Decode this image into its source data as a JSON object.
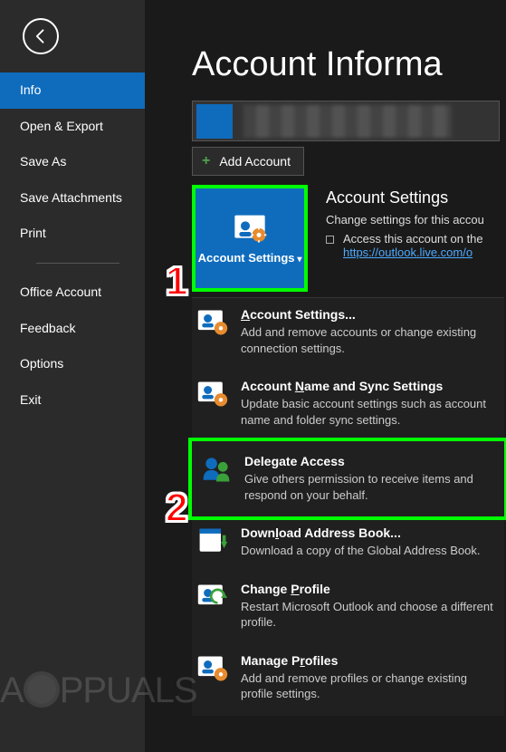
{
  "sidebar": {
    "items": [
      {
        "label": "Info"
      },
      {
        "label": "Open & Export"
      },
      {
        "label": "Save As"
      },
      {
        "label": "Save Attachments"
      },
      {
        "label": "Print"
      },
      {
        "label": "Office Account"
      },
      {
        "label": "Feedback"
      },
      {
        "label": "Options"
      },
      {
        "label": "Exit"
      }
    ],
    "active_index": 0
  },
  "main": {
    "title": "Account Informa",
    "add_account_label": "Add Account",
    "tile": {
      "label": "Account Settings"
    },
    "tile_info": {
      "title": "Account Settings",
      "subtitle": "Change settings for this accou",
      "bullet_text": "Access this account on the",
      "bullet_link": "https://outlook.live.com/o"
    },
    "dropdown": [
      {
        "title_pre": "",
        "title_ul": "A",
        "title_post": "ccount Settings...",
        "desc": "Add and remove accounts or change existing connection settings."
      },
      {
        "title_pre": "Account ",
        "title_ul": "N",
        "title_post": "ame and Sync Settings",
        "desc": "Update basic account settings such as account name and folder sync settings."
      },
      {
        "title_pre": "Delegate Access",
        "title_ul": "",
        "title_post": "",
        "desc": "Give others permission to receive items and respond on your behalf."
      },
      {
        "title_pre": "Down",
        "title_ul": "l",
        "title_post": "oad Address Book...",
        "desc": "Download a copy of the Global Address Book."
      },
      {
        "title_pre": "Change ",
        "title_ul": "P",
        "title_post": "rofile",
        "desc": "Restart Microsoft Outlook and choose a different profile."
      },
      {
        "title_pre": "Manage P",
        "title_ul": "r",
        "title_post": "ofiles",
        "desc": "Add and remove profiles or change existing profile settings."
      }
    ]
  },
  "callouts": {
    "one": "1",
    "two": "2"
  },
  "watermark": "PPUALS"
}
